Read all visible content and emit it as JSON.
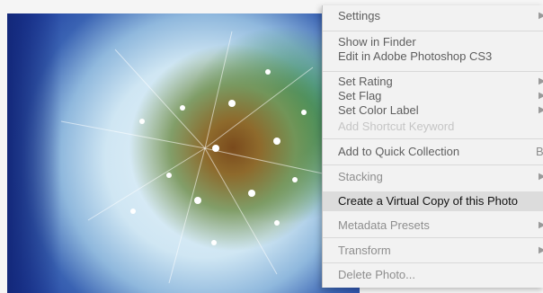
{
  "photo": {
    "subject_icon": "dandelion-photo"
  },
  "menu": {
    "items": [
      {
        "label": "Settings",
        "state": "normal",
        "submenu": true
      },
      {
        "label": "Show in Finder",
        "state": "normal",
        "submenu": false
      },
      {
        "label": "Edit in Adobe Photoshop CS3",
        "state": "normal",
        "submenu": false
      },
      {
        "label": "Set Rating",
        "state": "normal",
        "submenu": true
      },
      {
        "label": "Set Flag",
        "state": "normal",
        "submenu": true
      },
      {
        "label": "Set Color Label",
        "state": "normal",
        "submenu": true
      },
      {
        "label": "Add Shortcut Keyword",
        "state": "disabled",
        "submenu": false
      },
      {
        "label": "Add to Quick Collection",
        "state": "normal",
        "submenu": false,
        "shortcut": "B"
      },
      {
        "label": "Stacking",
        "state": "normal",
        "submenu": true
      },
      {
        "label": "Create a Virtual Copy of this Photo",
        "state": "highlighted",
        "submenu": false
      },
      {
        "label": "Metadata Presets",
        "state": "normal",
        "submenu": true
      },
      {
        "label": "Transform",
        "state": "normal",
        "submenu": true
      },
      {
        "label": "Delete Photo...",
        "state": "normal",
        "submenu": false
      }
    ],
    "submenu_arrow": "▶",
    "colors": {
      "background": "#f2f2f2",
      "highlight": "#dcdcdc",
      "text": "#8e8e8e",
      "text_disabled": "#c5c5c5"
    }
  }
}
